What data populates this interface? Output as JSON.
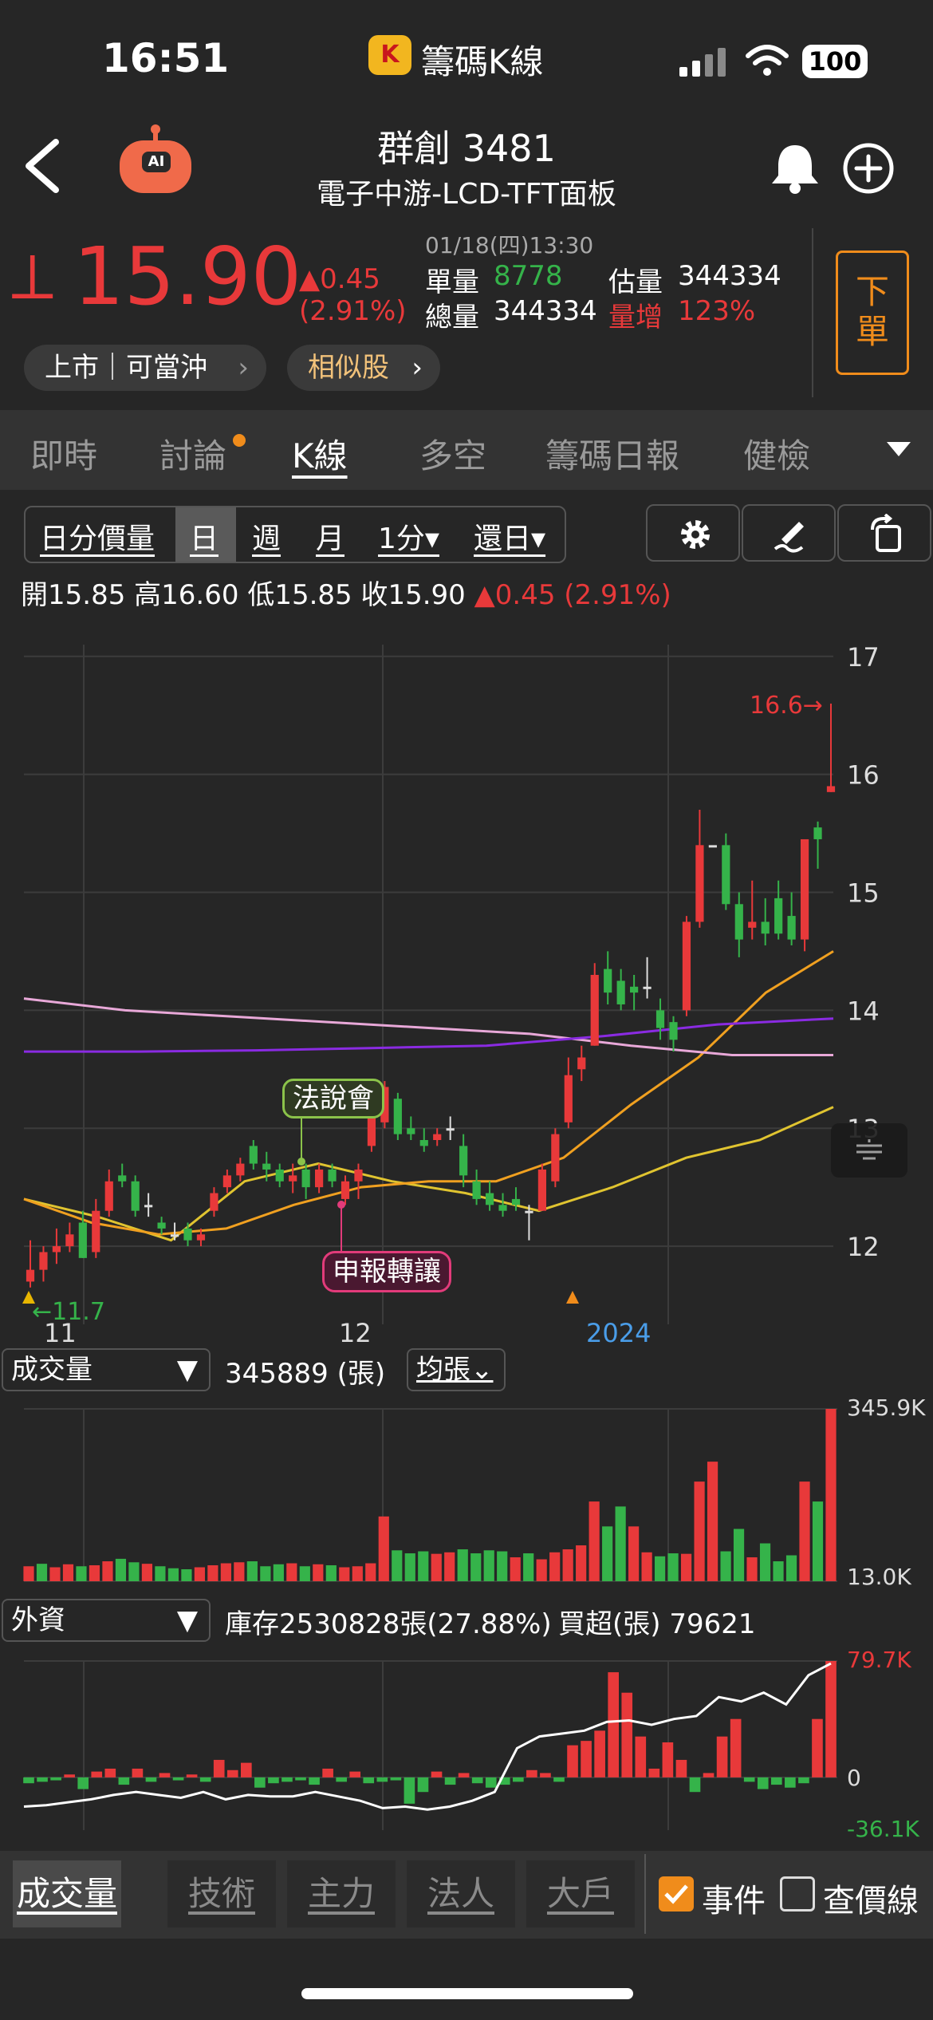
{
  "status_bar": {
    "time": "16:51",
    "app_name": "籌碼K線",
    "app_logo_letter": "K",
    "battery": "100"
  },
  "header": {
    "stock_name": "群創 3481",
    "sector": "電子中游-LCD-TFT面板",
    "ai_label": "AI"
  },
  "quote": {
    "arrow": "⟂",
    "price": "15.90",
    "change": "▲0.45",
    "change_pct": "(2.91%)",
    "datetime": "01/18(四)13:30",
    "single_vol_label": "單量",
    "single_vol": "8778",
    "est_vol_label": "估量",
    "est_vol": "344334",
    "total_vol_label": "總量",
    "total_vol": "344334",
    "vol_inc_label": "量增",
    "vol_inc": "123%",
    "chip_market": "上市｜可當沖",
    "chip_similar": "相似股",
    "order_label_1": "下",
    "order_label_2": "單"
  },
  "tabs": [
    {
      "label": "即時"
    },
    {
      "label": "討論"
    },
    {
      "label": "K線"
    },
    {
      "label": "多空"
    },
    {
      "label": "籌碼日報"
    },
    {
      "label": "健檢"
    }
  ],
  "tools": {
    "minute_price_vol": "日分價量",
    "day": "日",
    "week": "週",
    "month": "月",
    "one_min": "1分▾",
    "restore": "還日▾"
  },
  "ohlc": {
    "open_label": "開",
    "open": "15.85",
    "high_label": "高",
    "high": "16.60",
    "low_label": "低",
    "low": "15.85",
    "close_label": "收",
    "close": "15.90",
    "change": "▲0.45 (2.91%)"
  },
  "colors": {
    "up": "#e8393a",
    "down": "#35b34a",
    "accent": "#f08c1b",
    "ma_yellow": "#e0c430",
    "ma_orange": "#f0a020",
    "ma_pink": "#e8a8d8",
    "ma_purple": "#8a2be2"
  },
  "events": {
    "briefing": "法說會",
    "transfer": "申報轉讓"
  },
  "volume_panel": {
    "selector": "成交量",
    "value": "345889 (張)",
    "avg_selector": "均張⌄"
  },
  "foreign_panel": {
    "selector": "外資",
    "inventory": "庫存2530828張(27.88%)",
    "net_buy": "買超(張) 79621"
  },
  "bottom_tabs": [
    {
      "label": "成交量"
    },
    {
      "label": "技術"
    },
    {
      "label": "主力"
    },
    {
      "label": "法人"
    },
    {
      "label": "大戶"
    }
  ],
  "options": {
    "event_label": "事件",
    "event_checked": true,
    "price_line_label": "查價線",
    "price_line_checked": false
  },
  "chart_data": [
    {
      "type": "candlestick",
      "title": "",
      "x_ticks": [
        "11",
        "12",
        "2024"
      ],
      "y_ticks": [
        12,
        13,
        14,
        15,
        16,
        17
      ],
      "ylim": [
        11.5,
        17.1
      ],
      "annotations": [
        "16.6→",
        "←11.7"
      ],
      "candles": [
        {
          "o": 11.7,
          "h": 12.05,
          "l": 11.65,
          "c": 11.8
        },
        {
          "o": 11.8,
          "h": 12.0,
          "l": 11.7,
          "c": 11.95
        },
        {
          "o": 11.95,
          "h": 12.15,
          "l": 11.85,
          "c": 12.0
        },
        {
          "o": 12.0,
          "h": 12.2,
          "l": 11.95,
          "c": 12.1
        },
        {
          "o": 12.2,
          "h": 12.3,
          "l": 11.9,
          "c": 11.9
        },
        {
          "o": 11.95,
          "h": 12.4,
          "l": 11.9,
          "c": 12.3
        },
        {
          "o": 12.3,
          "h": 12.65,
          "l": 12.25,
          "c": 12.55
        },
        {
          "o": 12.6,
          "h": 12.7,
          "l": 12.5,
          "c": 12.55
        },
        {
          "o": 12.55,
          "h": 12.6,
          "l": 12.25,
          "c": 12.3
        },
        {
          "o": 12.35,
          "h": 12.45,
          "l": 12.25,
          "c": 12.35
        },
        {
          "o": 12.2,
          "h": 12.25,
          "l": 12.1,
          "c": 12.15
        },
        {
          "o": 12.1,
          "h": 12.2,
          "l": 12.05,
          "c": 12.1
        },
        {
          "o": 12.15,
          "h": 12.2,
          "l": 12.0,
          "c": 12.05
        },
        {
          "o": 12.05,
          "h": 12.15,
          "l": 12.0,
          "c": 12.1
        },
        {
          "o": 12.3,
          "h": 12.5,
          "l": 12.25,
          "c": 12.45
        },
        {
          "o": 12.5,
          "h": 12.65,
          "l": 12.45,
          "c": 12.6
        },
        {
          "o": 12.6,
          "h": 12.75,
          "l": 12.55,
          "c": 12.7
        },
        {
          "o": 12.85,
          "h": 12.9,
          "l": 12.65,
          "c": 12.7
        },
        {
          "o": 12.7,
          "h": 12.8,
          "l": 12.55,
          "c": 12.65
        },
        {
          "o": 12.65,
          "h": 12.7,
          "l": 12.5,
          "c": 12.55
        },
        {
          "o": 12.55,
          "h": 12.7,
          "l": 12.45,
          "c": 12.6
        },
        {
          "o": 12.65,
          "h": 12.7,
          "l": 12.4,
          "c": 12.5
        },
        {
          "o": 12.5,
          "h": 12.7,
          "l": 12.45,
          "c": 12.65
        },
        {
          "o": 12.65,
          "h": 12.7,
          "l": 12.5,
          "c": 12.55
        },
        {
          "o": 12.4,
          "h": 12.6,
          "l": 12.35,
          "c": 12.55
        },
        {
          "o": 12.55,
          "h": 12.7,
          "l": 12.4,
          "c": 12.65
        },
        {
          "o": 12.85,
          "h": 13.4,
          "l": 12.8,
          "c": 13.2
        },
        {
          "o": 13.05,
          "h": 13.4,
          "l": 13.0,
          "c": 13.35
        },
        {
          "o": 13.25,
          "h": 13.3,
          "l": 12.9,
          "c": 12.95
        },
        {
          "o": 13.0,
          "h": 13.1,
          "l": 12.9,
          "c": 12.95
        },
        {
          "o": 12.9,
          "h": 13.0,
          "l": 12.8,
          "c": 12.85
        },
        {
          "o": 12.9,
          "h": 13.0,
          "l": 12.85,
          "c": 12.95
        },
        {
          "o": 13.0,
          "h": 13.1,
          "l": 12.9,
          "c": 13.0
        },
        {
          "o": 12.85,
          "h": 12.95,
          "l": 12.5,
          "c": 12.6
        },
        {
          "o": 12.55,
          "h": 12.65,
          "l": 12.35,
          "c": 12.4
        },
        {
          "o": 12.45,
          "h": 12.55,
          "l": 12.3,
          "c": 12.35
        },
        {
          "o": 12.35,
          "h": 12.45,
          "l": 12.25,
          "c": 12.3
        },
        {
          "o": 12.4,
          "h": 12.5,
          "l": 12.3,
          "c": 12.35
        },
        {
          "o": 12.3,
          "h": 12.35,
          "l": 12.05,
          "c": 12.3
        },
        {
          "o": 12.3,
          "h": 12.7,
          "l": 12.3,
          "c": 12.65
        },
        {
          "o": 12.55,
          "h": 13.0,
          "l": 12.5,
          "c": 12.95
        },
        {
          "o": 13.05,
          "h": 13.6,
          "l": 13.0,
          "c": 13.45
        },
        {
          "o": 13.5,
          "h": 13.7,
          "l": 13.4,
          "c": 13.6
        },
        {
          "o": 13.7,
          "h": 14.4,
          "l": 13.7,
          "c": 14.3
        },
        {
          "o": 14.35,
          "h": 14.5,
          "l": 14.05,
          "c": 14.15
        },
        {
          "o": 14.25,
          "h": 14.35,
          "l": 14.0,
          "c": 14.05
        },
        {
          "o": 14.2,
          "h": 14.3,
          "l": 14.0,
          "c": 14.15
        },
        {
          "o": 14.2,
          "h": 14.45,
          "l": 14.1,
          "c": 14.2
        },
        {
          "o": 14.0,
          "h": 14.1,
          "l": 13.75,
          "c": 13.85
        },
        {
          "o": 13.9,
          "h": 13.95,
          "l": 13.65,
          "c": 13.75
        },
        {
          "o": 14.0,
          "h": 14.8,
          "l": 13.95,
          "c": 14.75
        },
        {
          "o": 14.75,
          "h": 15.7,
          "l": 14.7,
          "c": 15.4
        },
        {
          "o": 15.4,
          "h": 15.4,
          "l": 15.4,
          "c": 15.4
        },
        {
          "o": 15.4,
          "h": 15.5,
          "l": 14.85,
          "c": 14.9
        },
        {
          "o": 14.9,
          "h": 15.0,
          "l": 14.45,
          "c": 14.6
        },
        {
          "o": 14.7,
          "h": 15.1,
          "l": 14.6,
          "c": 14.75
        },
        {
          "o": 14.75,
          "h": 14.95,
          "l": 14.55,
          "c": 14.65
        },
        {
          "o": 14.95,
          "h": 15.1,
          "l": 14.6,
          "c": 14.65
        },
        {
          "o": 14.8,
          "h": 15.0,
          "l": 14.55,
          "c": 14.6
        },
        {
          "o": 14.6,
          "h": 15.45,
          "l": 14.5,
          "c": 15.45
        },
        {
          "o": 15.55,
          "h": 15.6,
          "l": 15.2,
          "c": 15.45
        },
        {
          "o": 15.85,
          "h": 16.6,
          "l": 15.85,
          "c": 15.9
        }
      ],
      "moving_averages": [
        {
          "color": "ma_yellow",
          "values": [
            12.4,
            12.25,
            12.05,
            12.55,
            12.7,
            12.55,
            12.45,
            12.3,
            12.5,
            12.75,
            12.9,
            13.18
          ]
        },
        {
          "color": "ma_orange",
          "values": [
            12.4,
            12.2,
            12.1,
            12.15,
            12.35,
            12.5,
            12.55,
            12.55,
            12.75,
            13.2,
            13.6,
            14.15,
            14.5
          ]
        },
        {
          "color": "ma_pink",
          "values": [
            14.1,
            14.0,
            13.95,
            13.9,
            13.85,
            13.8,
            13.7,
            13.62,
            13.62
          ]
        },
        {
          "color": "ma_purple",
          "values": [
            13.65,
            13.65,
            13.66,
            13.68,
            13.7,
            13.78,
            13.88,
            13.93
          ]
        }
      ]
    },
    {
      "type": "bar",
      "title": "成交量",
      "y_ticks": [
        "345.9K",
        "13.0K"
      ],
      "ylim": [
        0,
        345.9
      ],
      "series": [
        {
          "values": [
            30,
            35,
            28,
            34,
            30,
            32,
            40,
            45,
            38,
            35,
            30,
            26,
            24,
            28,
            32,
            36,
            38,
            40,
            30,
            34,
            36,
            30,
            34,
            32,
            28,
            30,
            36,
            130,
            62,
            56,
            60,
            55,
            58,
            64,
            56,
            62,
            60,
            48,
            56,
            44,
            58,
            64,
            72,
            160,
            110,
            150,
            110,
            58,
            50,
            56,
            55,
            200,
            240,
            60,
            105,
            48,
            76,
            40,
            52,
            200,
            160,
            345.9
          ],
          "up": [
            true,
            false,
            true,
            true,
            false,
            true,
            true,
            false,
            false,
            true,
            false,
            false,
            false,
            true,
            true,
            true,
            true,
            false,
            false,
            false,
            true,
            false,
            true,
            false,
            true,
            true,
            true,
            true,
            false,
            false,
            false,
            true,
            true,
            false,
            false,
            false,
            false,
            true,
            false,
            true,
            true,
            true,
            true,
            true,
            false,
            false,
            true,
            true,
            false,
            false,
            true,
            true,
            true,
            false,
            false,
            true,
            false,
            false,
            false,
            true,
            false,
            true
          ]
        }
      ]
    },
    {
      "type": "bar",
      "title": "外資",
      "y_ticks": [
        "79.7K",
        "0",
        "-36.1K"
      ],
      "ylim": [
        -36.1,
        79.7
      ],
      "series": [
        {
          "name": "net",
          "values": [
            -4,
            -3,
            -2,
            2,
            -8,
            4,
            6,
            -5,
            6,
            -3,
            3,
            -2,
            2,
            -3,
            12,
            5,
            10,
            -7,
            -4,
            -3,
            -2,
            -5,
            6,
            -3,
            4,
            -4,
            -3,
            -2,
            -18,
            -10,
            4,
            -5,
            3,
            -4,
            -7,
            -5,
            -3,
            5,
            3,
            -3,
            22,
            25,
            32,
            72,
            58,
            28,
            6,
            24,
            12,
            -10,
            3,
            28,
            40,
            -3,
            -8,
            -5,
            -7,
            -4,
            40,
            79.7
          ]
        },
        {
          "name": "cumulative",
          "values": [
            -20,
            -19,
            -17,
            -15,
            -12,
            -10,
            -12,
            -14,
            -10,
            -15,
            -12,
            -13,
            -13,
            -10,
            -13,
            -16,
            -21,
            -20,
            -22,
            -20,
            -16,
            -10,
            20,
            28,
            30,
            32,
            38,
            39,
            36,
            40,
            42,
            55,
            52,
            58,
            50,
            70,
            78
          ]
        }
      ]
    }
  ]
}
